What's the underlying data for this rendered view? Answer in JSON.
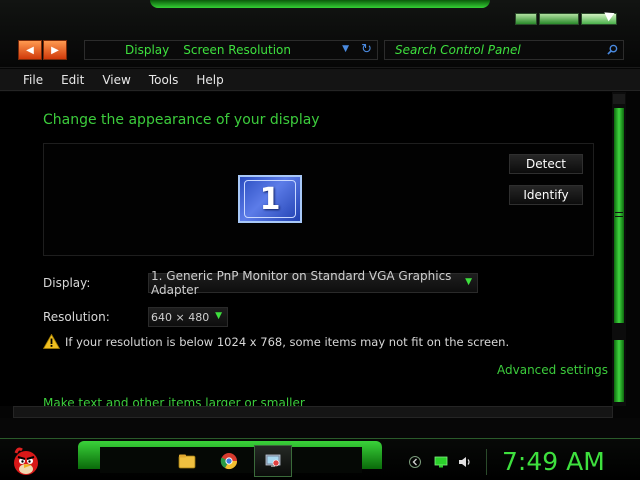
{
  "addressbar": {
    "crumbs": [
      "Display",
      "Screen Resolution"
    ],
    "search_placeholder": "Search Control Panel"
  },
  "menu": [
    "File",
    "Edit",
    "View",
    "Tools",
    "Help"
  ],
  "content": {
    "heading": "Change the appearance of your display",
    "monitor_number": "1",
    "detect_label": "Detect",
    "identify_label": "Identify",
    "display_label": "Display:",
    "display_value": "1. Generic PnP Monitor on Standard VGA Graphics Adapter",
    "resolution_label": "Resolution:",
    "resolution_value": "640 × 480",
    "warning_text": "If your resolution is below 1024 x 768, some items may not fit on the screen.",
    "advanced_link": "Advanced settings",
    "text_size_link": "Make text and other items larger or smaller"
  },
  "taskbar": {
    "clock": "7:49 AM",
    "pinned_icons": [
      "folder-icon",
      "chrome-icon",
      "display-settings-icon"
    ],
    "tray_icons": [
      "chevron-icon",
      "monitor-icon",
      "speaker-icon"
    ]
  },
  "colors": {
    "accent_green": "#3ccc3c",
    "nav_orange": "#e8601a",
    "monitor_blue": "#3a5cd0"
  }
}
